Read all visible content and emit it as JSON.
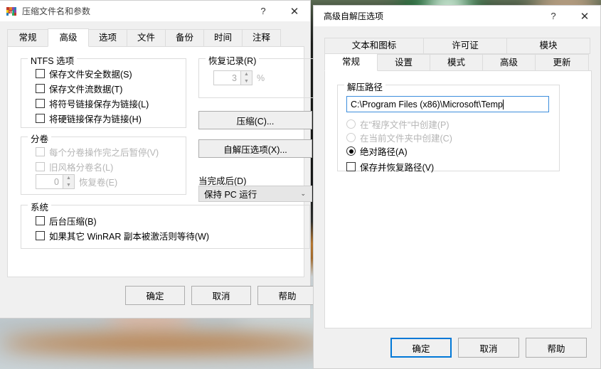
{
  "dialog1": {
    "title": "压缩文件名和参数",
    "help_btn": "?",
    "close_btn": "✕",
    "tabs": [
      {
        "label": "常规",
        "active": false
      },
      {
        "label": "高级",
        "active": true
      },
      {
        "label": "选项",
        "active": false
      },
      {
        "label": "文件",
        "active": false
      },
      {
        "label": "备份",
        "active": false
      },
      {
        "label": "时间",
        "active": false
      },
      {
        "label": "注释",
        "active": false
      }
    ],
    "ntfs_group": {
      "title": "NTFS 选项",
      "items": [
        {
          "label": "保存文件安全数据(S)",
          "checked": false,
          "disabled": false
        },
        {
          "label": "保存文件流数据(T)",
          "checked": false,
          "disabled": false
        },
        {
          "label": "将符号链接保存为链接(L)",
          "checked": false,
          "disabled": false
        },
        {
          "label": "将硬链接保存为链接(H)",
          "checked": false,
          "disabled": false
        }
      ]
    },
    "volume_group": {
      "title": "分卷",
      "items": [
        {
          "label": "每个分卷操作完之后暂停(V)",
          "checked": false,
          "disabled": true
        },
        {
          "label": "旧风格分卷名(L)",
          "checked": false,
          "disabled": true
        }
      ],
      "spinner_value": "0",
      "spinner_label": "恢复卷(E)"
    },
    "system_group": {
      "title": "系统",
      "items": [
        {
          "label": "后台压缩(B)",
          "checked": false,
          "disabled": false
        },
        {
          "label": "如果其它 WinRAR 副本被激活则等待(W)",
          "checked": false,
          "disabled": false
        }
      ]
    },
    "recovery_group": {
      "title": "恢复记录(R)",
      "spinner_value": "3",
      "suffix": "%"
    },
    "compress_button": "压缩(C)...",
    "sfx_button": "自解压选项(X)...",
    "after_done_label": "当完成后(D)",
    "after_done_value": "保持 PC 运行",
    "buttons": {
      "ok": "确定",
      "cancel": "取消",
      "help": "帮助"
    }
  },
  "dialog2": {
    "title": "高级自解压选项",
    "help_btn": "?",
    "close_btn": "✕",
    "tabs_row1": [
      {
        "label": "文本和图标",
        "active": false
      },
      {
        "label": "许可证",
        "active": false
      },
      {
        "label": "模块",
        "active": false
      }
    ],
    "tabs_row2": [
      {
        "label": "常规",
        "active": true
      },
      {
        "label": "设置",
        "active": false
      },
      {
        "label": "模式",
        "active": false
      },
      {
        "label": "高级",
        "active": false
      },
      {
        "label": "更新",
        "active": false
      }
    ],
    "path_group": {
      "title": "解压路径",
      "input_value": "C:\\Program Files (x86)\\Microsoft\\Temp",
      "radios": [
        {
          "label": "在\"程序文件\"中创建(P)",
          "checked": false,
          "disabled": true
        },
        {
          "label": "在当前文件夹中创建(C)",
          "checked": false,
          "disabled": true
        },
        {
          "label": "绝对路径(A)",
          "checked": true,
          "disabled": false
        }
      ],
      "checkbox": {
        "label": "保存并恢复路径(V)",
        "checked": false
      }
    },
    "buttons": {
      "ok": "确定",
      "cancel": "取消",
      "help": "帮助"
    }
  },
  "colors": {
    "accent": "#0078d7",
    "dialog_bg": "#f0f0f0",
    "panel_bg": "#ffffff",
    "input_border": "#3c8ddc"
  }
}
